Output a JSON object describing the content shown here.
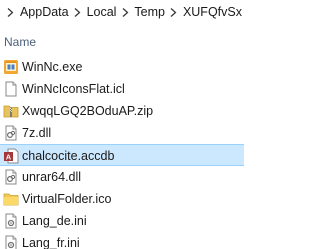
{
  "breadcrumb": {
    "items": [
      "AppData",
      "Local",
      "Temp",
      "XUFQfvSx"
    ]
  },
  "columns": {
    "name_label": "Name"
  },
  "files": [
    {
      "name": "WinNc.exe",
      "icon": "app-exe-icon"
    },
    {
      "name": "WinNcIconsFlat.icl",
      "icon": "generic-file-icon"
    },
    {
      "name": "XwqqLGQ2BOduAP.zip",
      "icon": "zip-archive-icon"
    },
    {
      "name": "7z.dll",
      "icon": "dll-file-icon"
    },
    {
      "name": "chalcocite.accdb",
      "icon": "access-database-icon",
      "selected": true
    },
    {
      "name": "unrar64.dll",
      "icon": "dll-file-icon"
    },
    {
      "name": "VirtualFolder.ico",
      "icon": "ico-image-icon"
    },
    {
      "name": "Lang_de.ini",
      "icon": "ini-settings-icon"
    },
    {
      "name": "Lang_fr.ini",
      "icon": "ini-settings-icon"
    }
  ],
  "colors": {
    "selection_background": "#cce8ff",
    "selection_border": "#99d1ff",
    "header_text": "#4c607a"
  }
}
